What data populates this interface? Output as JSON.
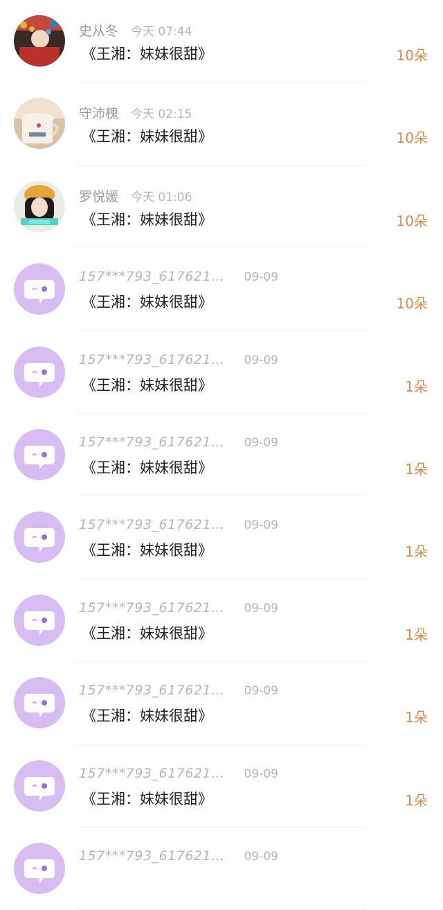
{
  "rows": [
    {
      "name": "史从冬",
      "time": "今天 07:44",
      "message": "《王湘：妹妹很甜》",
      "amount": "10朵",
      "avatar": "photo-opera"
    },
    {
      "name": "守沛槐",
      "time": "今天 02:15",
      "message": "《王湘：妹妹很甜》",
      "amount": "10朵",
      "avatar": "photo-cup"
    },
    {
      "name": "罗悦媛",
      "time": "今天 01:06",
      "message": "《王湘：妹妹很甜》",
      "amount": "10朵",
      "avatar": "photo-girl"
    },
    {
      "name": "157***793_617621…",
      "time": "09-09",
      "message": "《王湘：妹妹很甜》",
      "amount": "10朵",
      "avatar": "default-chat"
    },
    {
      "name": "157***793_617621…",
      "time": "09-09",
      "message": "《王湘：妹妹很甜》",
      "amount": "1朵",
      "avatar": "default-chat"
    },
    {
      "name": "157***793_617621…",
      "time": "09-09",
      "message": "《王湘：妹妹很甜》",
      "amount": "1朵",
      "avatar": "default-chat"
    },
    {
      "name": "157***793_617621…",
      "time": "09-09",
      "message": "《王湘：妹妹很甜》",
      "amount": "1朵",
      "avatar": "default-chat"
    },
    {
      "name": "157***793_617621…",
      "time": "09-09",
      "message": "《王湘：妹妹很甜》",
      "amount": "1朵",
      "avatar": "default-chat"
    },
    {
      "name": "157***793_617621…",
      "time": "09-09",
      "message": "《王湘：妹妹很甜》",
      "amount": "1朵",
      "avatar": "default-chat"
    },
    {
      "name": "157***793_617621…",
      "time": "09-09",
      "message": "《王湘：妹妹很甜》",
      "amount": "1朵",
      "avatar": "default-chat"
    },
    {
      "name": "157***793_617621…",
      "time": "09-09",
      "message": "",
      "amount": "",
      "avatar": "default-chat"
    }
  ],
  "colors": {
    "accent": "#d98b4e",
    "avatar_bg": "#d7bdf1"
  }
}
